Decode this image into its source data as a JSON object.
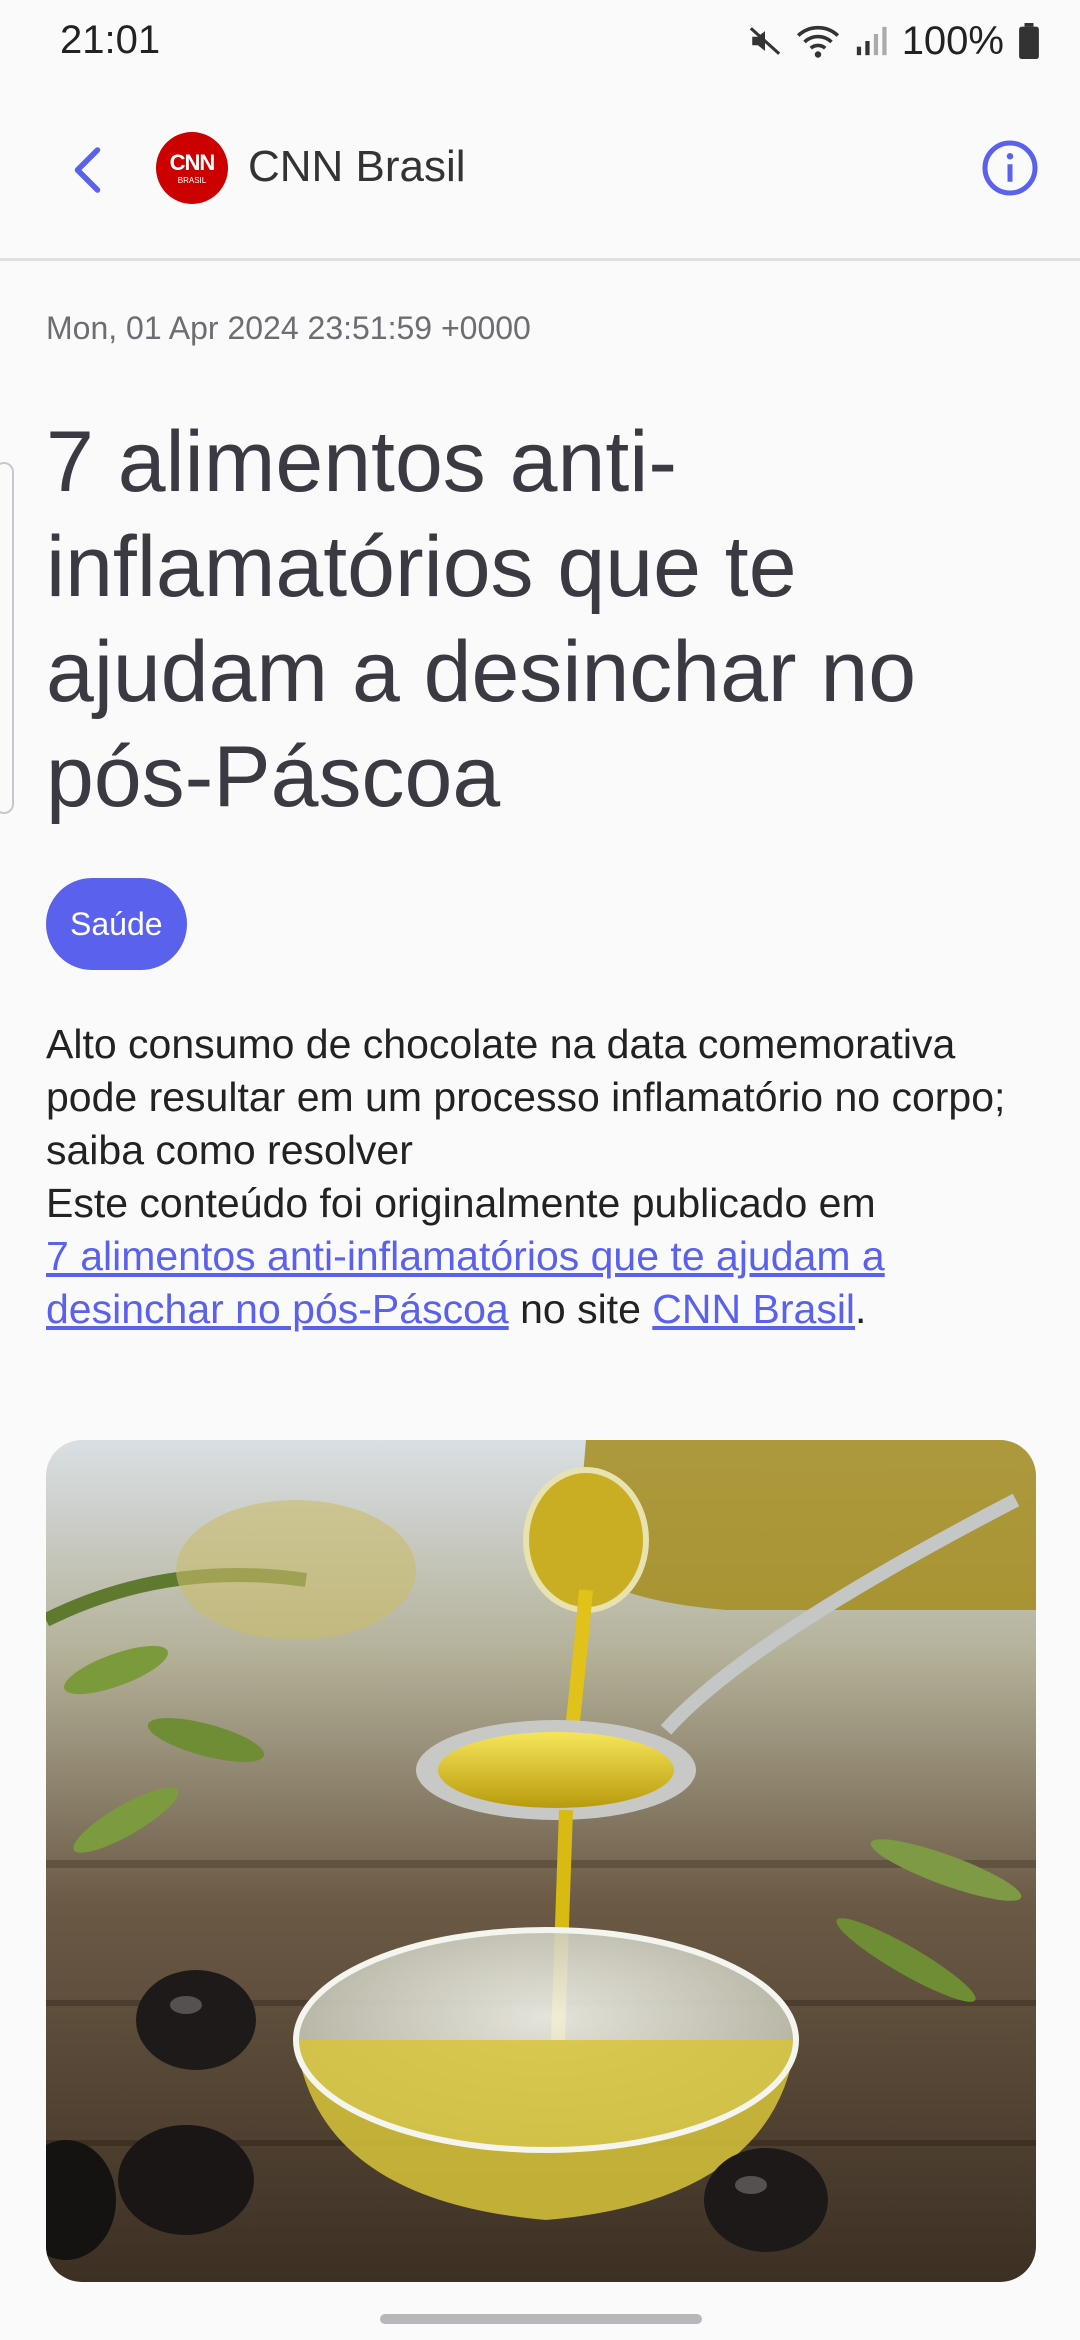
{
  "status_bar": {
    "time": "21:01",
    "battery_percent": "100%",
    "icons": [
      "mute-icon",
      "wifi-icon",
      "signal-icon",
      "battery-icon"
    ]
  },
  "app_bar": {
    "source_name": "CNN Brasil",
    "logo_text": "CNN",
    "logo_subtext": "BRASIL",
    "icons": [
      "back-arrow-icon",
      "info-icon"
    ]
  },
  "article": {
    "date": "Mon, 01 Apr 2024 23:51:59 +0000",
    "title": "7 alimentos anti-inflamatórios que te ajudam a desinchar no pós-Páscoa",
    "tag": "Saúde",
    "summary_line": "Alto consumo de chocolate na data comemorativa pode resultar em um processo inflamatório no corpo; saiba como resolver",
    "published_prefix": "Este conteúdo foi originalmente publicado em",
    "article_link": "7 alimentos anti-inflamatórios que te ajudam a desinchar no pós-Páscoa",
    "site_prefix": "no site",
    "site_link": "CNN Brasil",
    "period": "."
  },
  "colors": {
    "accent": "#5a61ed",
    "background": "#fafafa",
    "logo_red": "#cc0000"
  }
}
